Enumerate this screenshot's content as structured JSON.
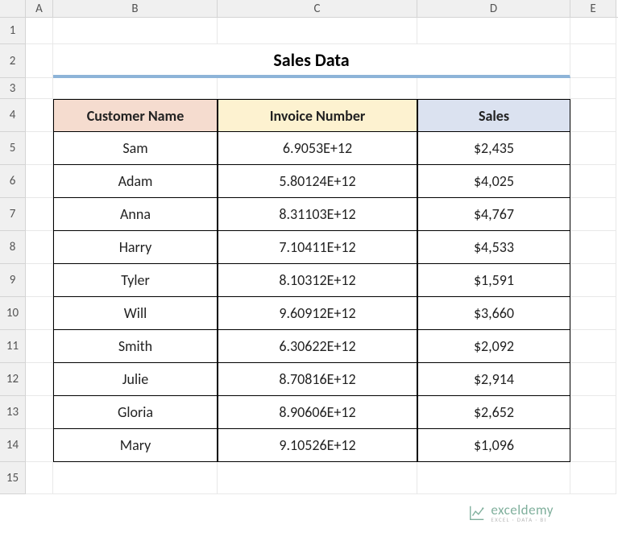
{
  "columns": [
    "A",
    "B",
    "C",
    "D",
    "E"
  ],
  "row_numbers": [
    "1",
    "2",
    "3",
    "4",
    "5",
    "6",
    "7",
    "8",
    "9",
    "10",
    "11",
    "12",
    "13",
    "14",
    "15"
  ],
  "title": "Sales Data",
  "headers": {
    "customer": "Customer Name",
    "invoice": "Invoice Number",
    "sales": "Sales"
  },
  "rows": [
    {
      "customer": "Sam",
      "invoice": "6.9053E+12",
      "sales": "$2,435"
    },
    {
      "customer": "Adam",
      "invoice": "5.80124E+12",
      "sales": "$4,025"
    },
    {
      "customer": "Anna",
      "invoice": "8.31103E+12",
      "sales": "$4,767"
    },
    {
      "customer": "Harry",
      "invoice": "7.10411E+12",
      "sales": "$4,533"
    },
    {
      "customer": "Tyler",
      "invoice": "8.10312E+12",
      "sales": "$1,591"
    },
    {
      "customer": "Will",
      "invoice": "9.60912E+12",
      "sales": "$3,660"
    },
    {
      "customer": "Smith",
      "invoice": "6.30622E+12",
      "sales": "$2,092"
    },
    {
      "customer": "Julie",
      "invoice": "8.70816E+12",
      "sales": "$2,914"
    },
    {
      "customer": "Gloria",
      "invoice": "8.90606E+12",
      "sales": "$2,652"
    },
    {
      "customer": "Mary",
      "invoice": "9.10526E+12",
      "sales": "$1,096"
    }
  ],
  "watermark": {
    "main": "exceldemy",
    "sub": "EXCEL · DATA · BI"
  }
}
